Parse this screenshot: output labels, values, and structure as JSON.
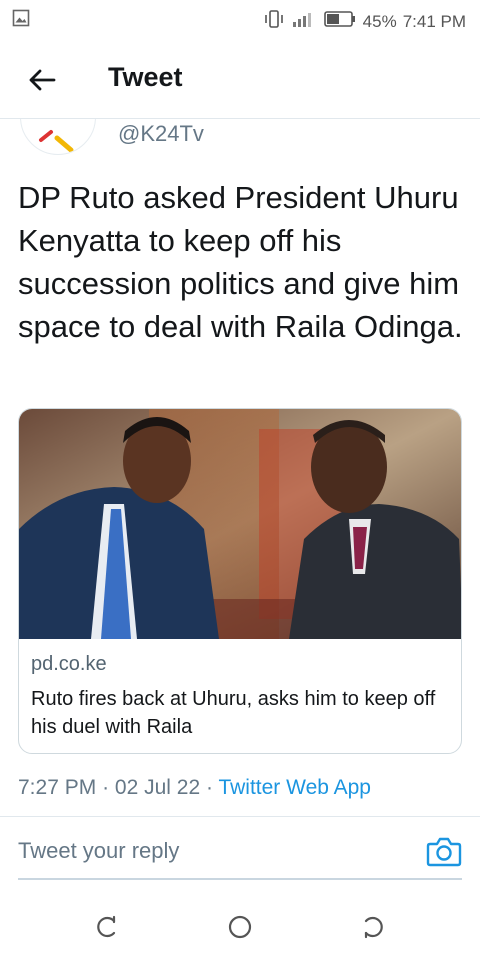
{
  "status_bar": {
    "battery": "45%",
    "time": "7:41 PM",
    "icons": [
      "image-notification-icon",
      "vibrate-icon",
      "signal-icon",
      "battery-icon"
    ]
  },
  "header": {
    "title": "Tweet",
    "back_icon": "arrow-left-icon"
  },
  "author": {
    "handle": "@K24Tv"
  },
  "tweet": {
    "text": "DP Ruto asked President Uhuru Kenyatta to keep off his succession politics and give him space to deal with Raila Odinga."
  },
  "link_card": {
    "domain": "pd.co.ke",
    "title": "Ruto fires back at Uhuru, asks him to keep off his duel with Raila"
  },
  "meta": {
    "time": "7:27 PM",
    "separator": "·",
    "date": "02 Jul 22",
    "source": "Twitter Web App"
  },
  "reply": {
    "placeholder": "Tweet your reply",
    "camera_icon": "camera-icon"
  },
  "nav": {
    "icons": [
      "recent-apps-icon",
      "home-icon",
      "back-nav-icon"
    ]
  },
  "colors": {
    "accent": "#1b95e0",
    "secondary_text": "#657786",
    "primary_text": "#14171a"
  }
}
